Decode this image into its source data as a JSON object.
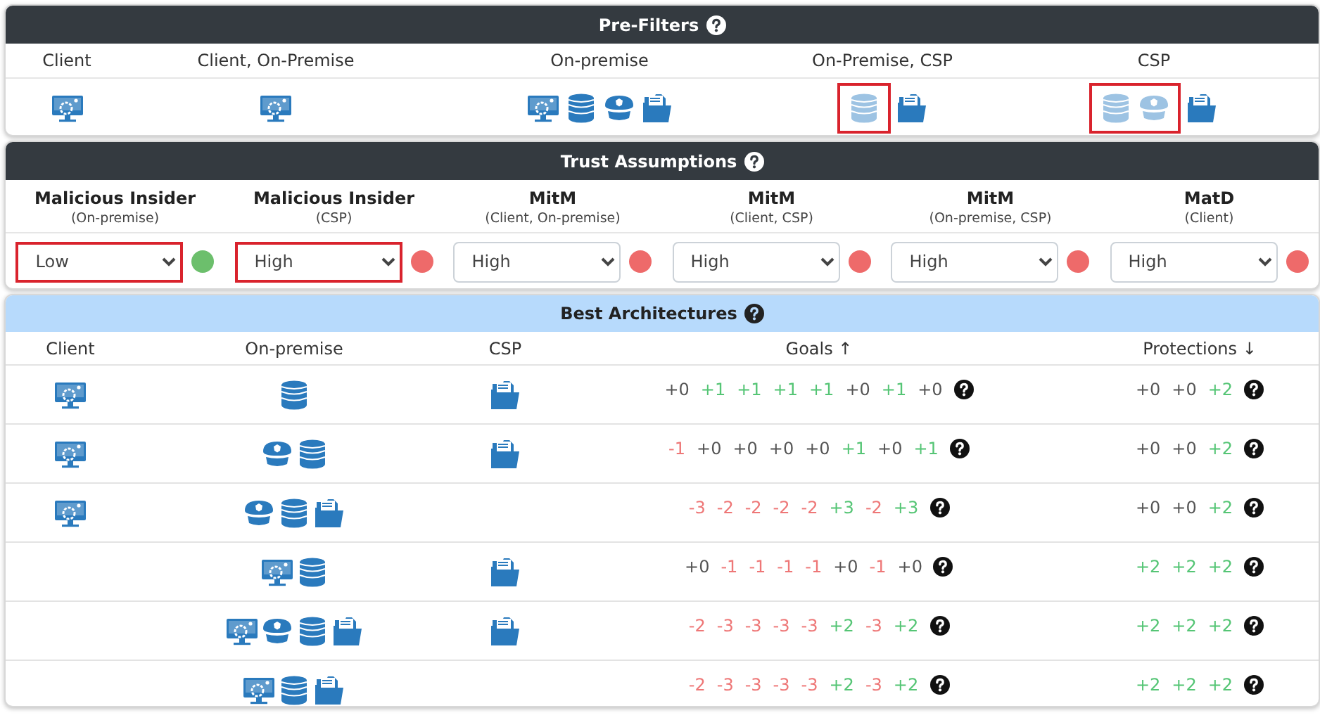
{
  "pre_filters": {
    "title": "Pre-Filters",
    "columns": [
      {
        "label": "Client",
        "icons": [
          {
            "kind": "monitor",
            "excluded": false
          }
        ]
      },
      {
        "label": "Client, On-Premise",
        "icons": [
          {
            "kind": "monitor",
            "excluded": false
          }
        ]
      },
      {
        "label": "On-premise",
        "icons": [
          {
            "kind": "monitor",
            "excluded": false
          },
          {
            "kind": "database",
            "excluded": false
          },
          {
            "kind": "cap",
            "excluded": false
          },
          {
            "kind": "folder",
            "excluded": false
          }
        ]
      },
      {
        "label": "On-Premise, CSP",
        "icons": [
          {
            "kind": "database",
            "excluded": true
          },
          {
            "kind": "folder",
            "excluded": false
          }
        ]
      },
      {
        "label": "CSP",
        "icons": [
          {
            "kind": "database",
            "excluded": true
          },
          {
            "kind": "cap",
            "excluded": true
          },
          {
            "kind": "folder",
            "excluded": false
          }
        ]
      }
    ]
  },
  "trust_assumptions": {
    "title": "Trust Assumptions",
    "columns": [
      {
        "name": "Malicious Insider",
        "scope": "(On-premise)",
        "value": "Low",
        "highlighted": true,
        "color": "#6cbf6c"
      },
      {
        "name": "Malicious Insider",
        "scope": "(CSP)",
        "value": "High",
        "highlighted": true,
        "color": "#ee6a6a"
      },
      {
        "name": "MitM",
        "scope": "(Client, On-premise)",
        "value": "High",
        "highlighted": false,
        "color": "#ee6a6a"
      },
      {
        "name": "MitM",
        "scope": "(Client, CSP)",
        "value": "High",
        "highlighted": false,
        "color": "#ee6a6a"
      },
      {
        "name": "MitM",
        "scope": "(On-premise, CSP)",
        "value": "High",
        "highlighted": false,
        "color": "#ee6a6a"
      },
      {
        "name": "MatD",
        "scope": "(Client)",
        "value": "High",
        "highlighted": false,
        "color": "#ee6a6a"
      }
    ]
  },
  "best_architectures": {
    "title": "Best Architectures",
    "columns": [
      "Client",
      "On-premise",
      "CSP",
      "Goals ↑",
      "Protections ↓"
    ],
    "rows": [
      {
        "client": [
          {
            "kind": "monitor"
          }
        ],
        "on_premise": [
          {
            "kind": "database"
          }
        ],
        "csp": [
          {
            "kind": "folder"
          }
        ],
        "goals": [
          {
            "text": "+0",
            "color": "#555555"
          },
          {
            "text": "+1",
            "color": "#55c575"
          },
          {
            "text": "+1",
            "color": "#55c575"
          },
          {
            "text": "+1",
            "color": "#55c575"
          },
          {
            "text": "+1",
            "color": "#55c575"
          },
          {
            "text": "+0",
            "color": "#555555"
          },
          {
            "text": "+1",
            "color": "#55c575"
          },
          {
            "text": "+0",
            "color": "#555555"
          }
        ],
        "protections": [
          {
            "text": "+0",
            "color": "#555555"
          },
          {
            "text": "+0",
            "color": "#555555"
          },
          {
            "text": "+2",
            "color": "#55c575"
          }
        ]
      },
      {
        "client": [
          {
            "kind": "monitor"
          }
        ],
        "on_premise": [
          {
            "kind": "cap"
          },
          {
            "kind": "database"
          }
        ],
        "csp": [
          {
            "kind": "folder"
          }
        ],
        "goals": [
          {
            "text": "-1",
            "color": "#ee7777"
          },
          {
            "text": "+0",
            "color": "#555555"
          },
          {
            "text": "+0",
            "color": "#555555"
          },
          {
            "text": "+0",
            "color": "#555555"
          },
          {
            "text": "+0",
            "color": "#555555"
          },
          {
            "text": "+1",
            "color": "#55c575"
          },
          {
            "text": "+0",
            "color": "#555555"
          },
          {
            "text": "+1",
            "color": "#55c575"
          }
        ],
        "protections": [
          {
            "text": "+0",
            "color": "#555555"
          },
          {
            "text": "+0",
            "color": "#555555"
          },
          {
            "text": "+2",
            "color": "#55c575"
          }
        ]
      },
      {
        "client": [
          {
            "kind": "monitor"
          }
        ],
        "on_premise": [
          {
            "kind": "cap"
          },
          {
            "kind": "database"
          },
          {
            "kind": "folder"
          }
        ],
        "csp": [],
        "goals": [
          {
            "text": "-3",
            "color": "#ee7777"
          },
          {
            "text": "-2",
            "color": "#ee7777"
          },
          {
            "text": "-2",
            "color": "#ee7777"
          },
          {
            "text": "-2",
            "color": "#ee7777"
          },
          {
            "text": "-2",
            "color": "#ee7777"
          },
          {
            "text": "+3",
            "color": "#55c575"
          },
          {
            "text": "-2",
            "color": "#ee7777"
          },
          {
            "text": "+3",
            "color": "#55c575"
          }
        ],
        "protections": [
          {
            "text": "+0",
            "color": "#555555"
          },
          {
            "text": "+0",
            "color": "#555555"
          },
          {
            "text": "+2",
            "color": "#55c575"
          }
        ]
      },
      {
        "client": [],
        "on_premise": [
          {
            "kind": "monitor"
          },
          {
            "kind": "database"
          }
        ],
        "csp": [
          {
            "kind": "folder"
          }
        ],
        "goals": [
          {
            "text": "+0",
            "color": "#555555"
          },
          {
            "text": "-1",
            "color": "#ee7777"
          },
          {
            "text": "-1",
            "color": "#ee7777"
          },
          {
            "text": "-1",
            "color": "#ee7777"
          },
          {
            "text": "-1",
            "color": "#ee7777"
          },
          {
            "text": "+0",
            "color": "#555555"
          },
          {
            "text": "-1",
            "color": "#ee7777"
          },
          {
            "text": "+0",
            "color": "#555555"
          }
        ],
        "protections": [
          {
            "text": "+2",
            "color": "#55c575"
          },
          {
            "text": "+2",
            "color": "#55c575"
          },
          {
            "text": "+2",
            "color": "#55c575"
          }
        ]
      },
      {
        "client": [],
        "on_premise": [
          {
            "kind": "monitor"
          },
          {
            "kind": "cap"
          },
          {
            "kind": "database"
          },
          {
            "kind": "folder"
          }
        ],
        "csp": [
          {
            "kind": "folder"
          }
        ],
        "goals": [
          {
            "text": "-2",
            "color": "#ee7777"
          },
          {
            "text": "-3",
            "color": "#ee7777"
          },
          {
            "text": "-3",
            "color": "#ee7777"
          },
          {
            "text": "-3",
            "color": "#ee7777"
          },
          {
            "text": "-3",
            "color": "#ee7777"
          },
          {
            "text": "+2",
            "color": "#55c575"
          },
          {
            "text": "-3",
            "color": "#ee7777"
          },
          {
            "text": "+2",
            "color": "#55c575"
          }
        ],
        "protections": [
          {
            "text": "+2",
            "color": "#55c575"
          },
          {
            "text": "+2",
            "color": "#55c575"
          },
          {
            "text": "+2",
            "color": "#55c575"
          }
        ]
      },
      {
        "client": [],
        "on_premise": [
          {
            "kind": "monitor"
          },
          {
            "kind": "database"
          },
          {
            "kind": "folder"
          }
        ],
        "csp": [],
        "goals": [
          {
            "text": "-2",
            "color": "#ee7777"
          },
          {
            "text": "-3",
            "color": "#ee7777"
          },
          {
            "text": "-3",
            "color": "#ee7777"
          },
          {
            "text": "-3",
            "color": "#ee7777"
          },
          {
            "text": "-3",
            "color": "#ee7777"
          },
          {
            "text": "+2",
            "color": "#55c575"
          },
          {
            "text": "-3",
            "color": "#ee7777"
          },
          {
            "text": "+2",
            "color": "#55c575"
          }
        ],
        "protections": [
          {
            "text": "+2",
            "color": "#55c575"
          },
          {
            "text": "+2",
            "color": "#55c575"
          },
          {
            "text": "+2",
            "color": "#55c575"
          }
        ]
      }
    ]
  }
}
